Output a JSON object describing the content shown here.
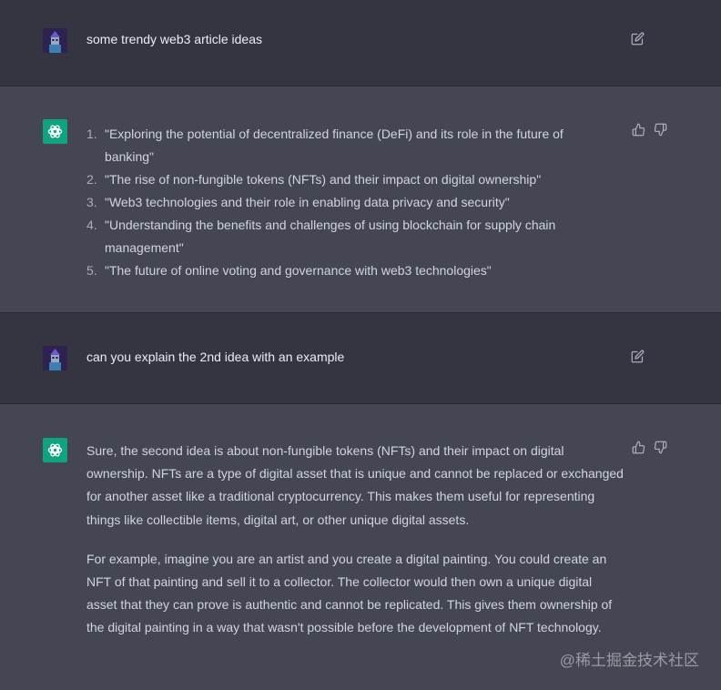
{
  "conversation": [
    {
      "role": "user",
      "text": "some trendy web3 article ideas"
    },
    {
      "role": "assistant",
      "list": [
        {
          "num": "1.",
          "text": "\"Exploring the potential of decentralized finance (DeFi) and its role in the future of banking\""
        },
        {
          "num": "2.",
          "text": "\"The rise of non-fungible tokens (NFTs) and their impact on digital ownership\""
        },
        {
          "num": "3.",
          "text": "\"Web3 technologies and their role in enabling data privacy and security\""
        },
        {
          "num": "4.",
          "text": "\"Understanding the benefits and challenges of using blockchain for supply chain management\""
        },
        {
          "num": "5.",
          "text": "\"The future of online voting and governance with web3 technologies\""
        }
      ]
    },
    {
      "role": "user",
      "text": "can you explain the 2nd idea with an example"
    },
    {
      "role": "assistant",
      "paragraphs": [
        "Sure, the second idea is about non-fungible tokens (NFTs) and their impact on digital ownership. NFTs are a type of digital asset that is unique and cannot be replaced or exchanged for another asset like a traditional cryptocurrency. This makes them useful for representing things like collectible items, digital art, or other unique digital assets.",
        "For example, imagine you are an artist and you create a digital painting. You could create an NFT of that painting and sell it to a collector. The collector would then own a unique digital asset that they can prove is authentic and cannot be replicated. This gives them ownership of the digital painting in a way that wasn't possible before the development of NFT technology."
      ]
    }
  ],
  "watermark": "@稀土掘金技术社区",
  "icons": {
    "edit": "edit-icon",
    "thumbs_up": "thumbs-up-icon",
    "thumbs_down": "thumbs-down-icon",
    "bot_logo": "openai-logo-icon"
  },
  "colors": {
    "user_bg": "#343541",
    "assistant_bg": "#444654",
    "bot_avatar": "#10a37f"
  }
}
